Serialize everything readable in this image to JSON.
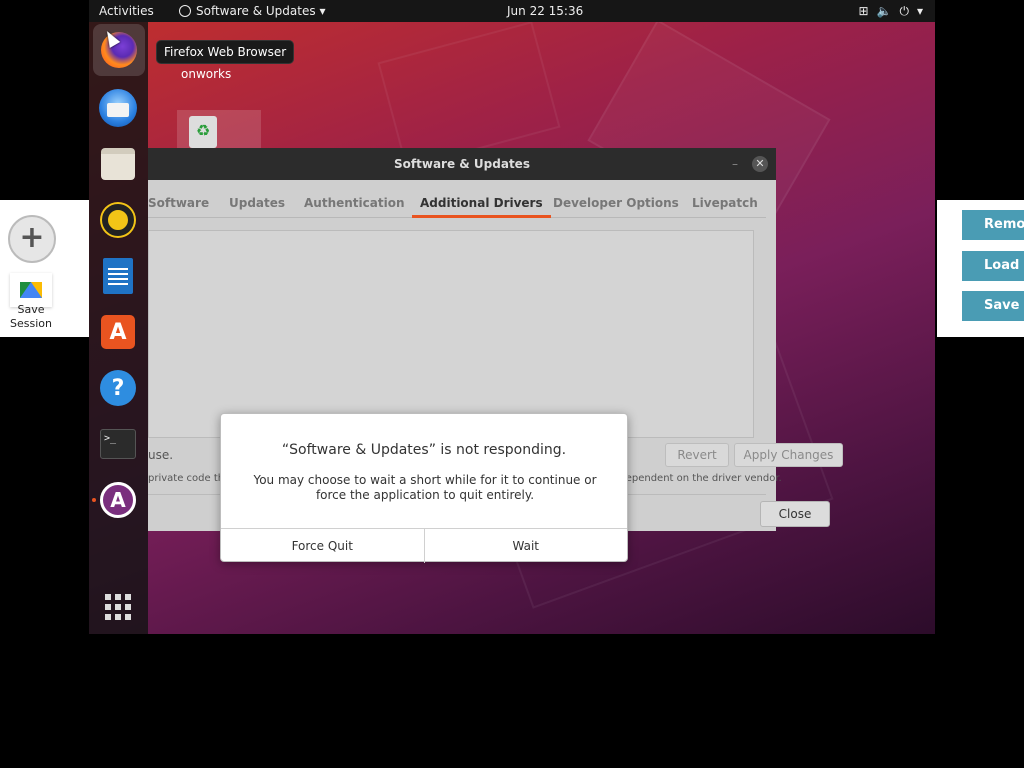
{
  "topbar": {
    "activities": "Activities",
    "app_menu": "Software & Updates",
    "clock": "Jun 22  15:36"
  },
  "dock": {
    "tooltip": "Firefox Web Browser",
    "items": [
      "firefox",
      "thunderbird",
      "files",
      "rhythmbox",
      "libreoffice-writer",
      "software-center",
      "help",
      "terminal",
      "software-updater"
    ]
  },
  "desktop": {
    "label": "onworks"
  },
  "window": {
    "title": "Software & Updates",
    "tabs": [
      "Software",
      "Updates",
      "Authentication",
      "Additional Drivers",
      "Developer Options",
      "Livepatch"
    ],
    "selected_tab": "Additional Drivers",
    "partial_text": "use.",
    "note": "private code that Ubuntu developers can't review or improve. Security and other updates are dependent on the driver vendor.",
    "revert": "Revert",
    "apply": "Apply Changes",
    "close": "Close"
  },
  "dialog": {
    "title": "“Software & Updates” is not responding.",
    "body": "You may choose to wait a short while for it to continue or force the application to quit entirely.",
    "force_quit": "Force Quit",
    "wait": "Wait"
  },
  "host": {
    "save_session": "Save Session",
    "buttons": [
      "Remo",
      "Load r",
      "Save r"
    ]
  },
  "colors": {
    "accent": "#e95420",
    "host_button": "#4a9cb4"
  }
}
